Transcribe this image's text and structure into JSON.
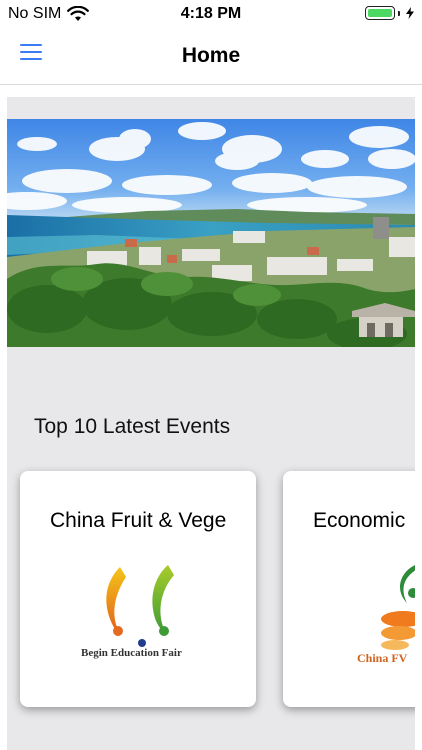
{
  "status_bar": {
    "carrier": "No SIM",
    "time": "4:18 PM",
    "battery_level": 1.0
  },
  "nav": {
    "title": "Home"
  },
  "hero": {
    "icon": "city-coast-photo"
  },
  "events": {
    "section_title": "Top 10 Latest Events",
    "cards": [
      {
        "title": "China Fruit & Vegetable",
        "logo_text": "Begin Education Fair"
      },
      {
        "title": "Economic",
        "logo_text": "China FV"
      }
    ]
  },
  "colors": {
    "accent": "#3b7cf5",
    "battery": "#4cd964",
    "content_bg": "#e8e8ea"
  }
}
